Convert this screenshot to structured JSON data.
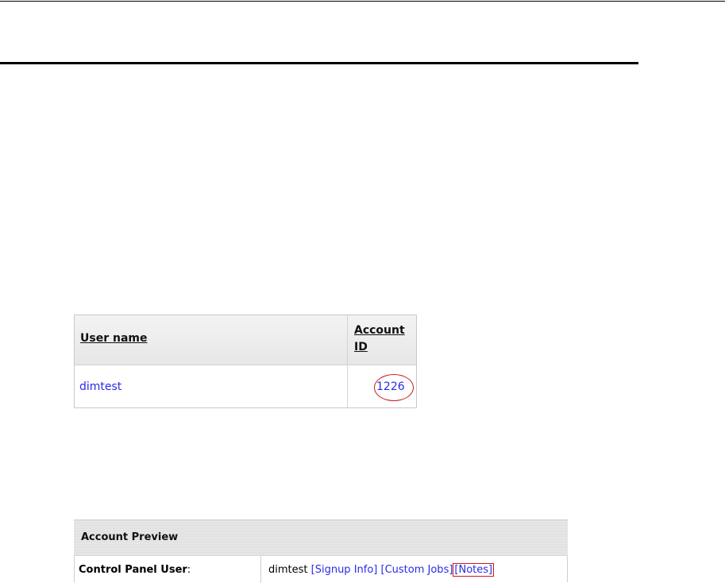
{
  "users_table": {
    "headers": {
      "user_name": "User name",
      "account_id_line1": "Account",
      "account_id_line2": "ID"
    },
    "rows": [
      {
        "user_name": "dimtest",
        "account_id": "1226"
      }
    ],
    "highlight_color": "#d01818",
    "link_color": "#2a2ae8"
  },
  "account_preview": {
    "title": "Account Preview",
    "row_label": "Control Panel User",
    "row_label_suffix": ":",
    "user": "dimtest",
    "links": {
      "signup_info": "[Signup Info]",
      "custom_jobs": "[Custom Jobs]",
      "notes": "[Notes]"
    }
  }
}
